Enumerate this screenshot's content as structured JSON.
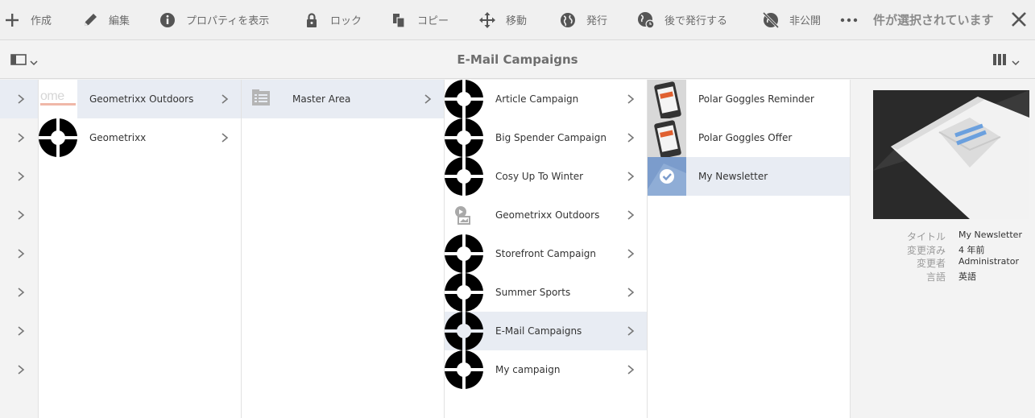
{
  "actionbar": {
    "items": [
      {
        "label": "作成",
        "icon": "plus-icon"
      },
      {
        "label": "編集",
        "icon": "pencil-icon"
      },
      {
        "label": "プロパティを表示",
        "icon": "info-icon"
      },
      {
        "label": "ロック",
        "icon": "lock-icon"
      },
      {
        "label": "コピー",
        "icon": "copy-icon"
      },
      {
        "label": "移動",
        "icon": "move-icon"
      },
      {
        "label": "発行",
        "icon": "globe-icon"
      },
      {
        "label": "後で発行する",
        "icon": "globe-clock-icon"
      },
      {
        "label": "非公開",
        "icon": "globe-off-icon"
      }
    ],
    "more_icon": "more-icon",
    "selection_text": "件が選択されています",
    "close_icon": "close-icon"
  },
  "titlebar": {
    "title": "E-Mail Campaigns",
    "rail_icon": "rail-toggle-icon",
    "view_icon": "column-view-icon"
  },
  "columns": {
    "col1": [
      {
        "label": "Geometrixx Outdoors",
        "thumb": "ome",
        "selected": true
      },
      {
        "label": "Geometrixx",
        "thumb": "geometrixx-logo",
        "selected": false
      }
    ],
    "col2": [
      {
        "label": "Master Area",
        "thumb": "folder-list-icon",
        "selected": true
      }
    ],
    "col3": [
      {
        "label": "Article Campaign",
        "selected": false
      },
      {
        "label": "Big Spender Campaign",
        "selected": false
      },
      {
        "label": "Cosy Up To Winter",
        "selected": false
      },
      {
        "label": "Geometrixx Outdoors",
        "thumb": "image-file-icon",
        "selected": false
      },
      {
        "label": "Storefront Campaign",
        "selected": false
      },
      {
        "label": "Summer Sports",
        "selected": false
      },
      {
        "label": "E-Mail Campaigns",
        "selected": true
      },
      {
        "label": "My campaign",
        "selected": false
      }
    ],
    "col4": [
      {
        "label": "Polar Goggles Reminder",
        "selected": false
      },
      {
        "label": "Polar Goggles Offer",
        "selected": false
      },
      {
        "label": "My Newsletter",
        "selected": true
      }
    ]
  },
  "preview": {
    "meta": [
      {
        "key": "タイトル",
        "value": "My Newsletter"
      },
      {
        "key": "変更済み",
        "value": "4 年前"
      },
      {
        "key": "変更者",
        "value": "Administrator"
      },
      {
        "key": "言語",
        "value": "英語"
      }
    ]
  },
  "colors": {
    "selected_row": "#e8ecf3",
    "actionbar_bg": "#f0f0f0",
    "text": "#333333"
  }
}
